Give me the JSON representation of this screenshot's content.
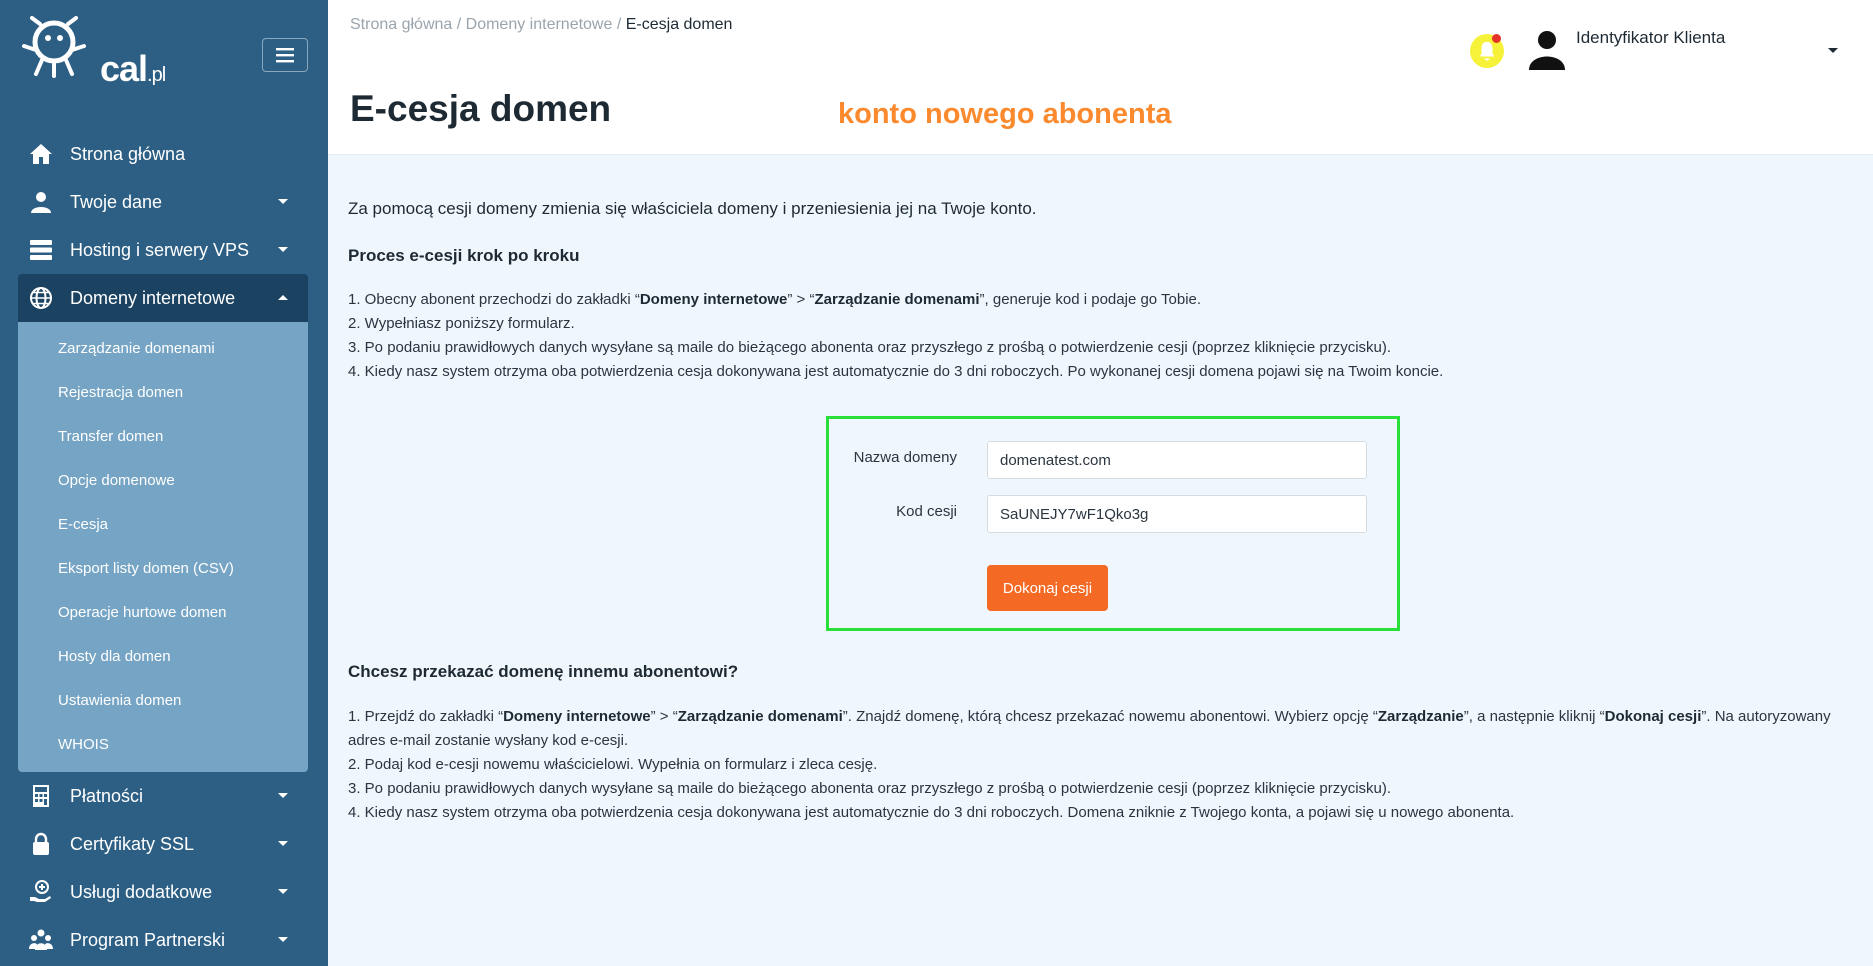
{
  "logo": {
    "text": "cal",
    "suffix": ".pl"
  },
  "sidebar": {
    "items": [
      {
        "label": "Strona główna"
      },
      {
        "label": "Twoje dane"
      },
      {
        "label": "Hosting i serwery VPS"
      },
      {
        "label": "Domeny internetowe"
      },
      {
        "label": "Płatności"
      },
      {
        "label": "Certyfikaty SSL"
      },
      {
        "label": "Usługi dodatkowe"
      },
      {
        "label": "Program Partnerski"
      }
    ],
    "subitems": [
      "Zarządzanie domenami",
      "Rejestracja domen",
      "Transfer domen",
      "Opcje domenowe",
      "E-cesja",
      "Eksport listy domen (CSV)",
      "Operacje hurtowe domen",
      "Hosty dla domen",
      "Ustawienia domen",
      "WHOIS"
    ]
  },
  "header": {
    "breadcrumb": [
      "Strona główna /",
      "Domeny internetowe /",
      "E-cesja domen"
    ],
    "title": "E-cesja domen",
    "annotation": "konto nowego abonenta",
    "user_name": "Identyfikator Klienta"
  },
  "content": {
    "intro": "Za pomocą cesji domeny zmienia się właściciela domeny i przeniesienia jej na Twoje konto.",
    "process_heading": "Proces e-cesji krok po kroku",
    "process_steps": {
      "s1_a": "1. Obecny abonent przechodzi do zakładki “",
      "s1_b": "Domeny internetowe",
      "s1_c": "” > “",
      "s1_d": "Zarządzanie domenami",
      "s1_e": "”, generuje kod i podaje go Tobie.",
      "s2": "2. Wypełniasz poniższy formularz.",
      "s3": "3. Po podaniu prawidłowych danych wysyłane są maile do bieżącego abonenta oraz przyszłego z prośbą o potwierdzenie cesji (poprzez kliknięcie przycisku).",
      "s4": "4. Kiedy nasz system otrzyma oba potwierdzenia cesja dokonywana jest automatycznie do 3 dni roboczych. Po wykonanej cesji domena pojawi się na Twoim koncie."
    },
    "form": {
      "domain_label": "Nazwa domeny",
      "domain_value": "domenatest.com",
      "code_label": "Kod cesji",
      "code_value": "SaUNEJY7wF1Qko3g",
      "submit_label": "Dokonaj cesji"
    },
    "transfer_heading": "Chcesz przekazać domenę innemu abonentowi?",
    "transfer_steps": {
      "t1_a": "1. Przejdź do zakładki “",
      "t1_b": "Domeny internetowe",
      "t1_c": "” > “",
      "t1_d": "Zarządzanie domenami",
      "t1_e": "”. Znajdź domenę, którą chcesz przekazać nowemu abonentowi. Wybierz opcję “",
      "t1_f": "Zarządzanie",
      "t1_g": "”, a następnie kliknij “",
      "t1_h": "Dokonaj cesji",
      "t1_i": "”. Na autoryzowany adres e-mail zostanie wysłany kod e-cesji.",
      "t2": "2. Podaj kod e-cesji nowemu właścicielowi. Wypełnia on formularz i zleca cesję.",
      "t3": "3. Po podaniu prawidłowych danych wysyłane są maile do bieżącego abonenta oraz przyszłego z prośbą o potwierdzenie cesji (poprzez kliknięcie przycisku).",
      "t4": "4. Kiedy nasz system otrzyma oba potwierdzenia cesja dokonywana jest automatycznie do 3 dni roboczych. Domena zniknie z Twojego konta, a pojawi się u nowego abonenta."
    }
  },
  "colors": {
    "sidebar": "#2d5f84",
    "sidebar_active": "#1b4261",
    "submenu": "#76a4c4",
    "accent": "#f46a25",
    "annotation": "#fb8a2e",
    "highlight_box": "#29e03a"
  },
  "icons": {
    "menu": "hamburger-icon",
    "home": "home-icon",
    "user": "user-icon",
    "server": "server-icon",
    "globe": "globe-icon",
    "calculator": "calculator-icon",
    "lock": "lock-icon",
    "services": "hand-plus-icon",
    "partners": "users-group-icon",
    "notification": "bell-icon",
    "avatar": "avatar-icon",
    "dropdown": "caret-down-icon"
  }
}
